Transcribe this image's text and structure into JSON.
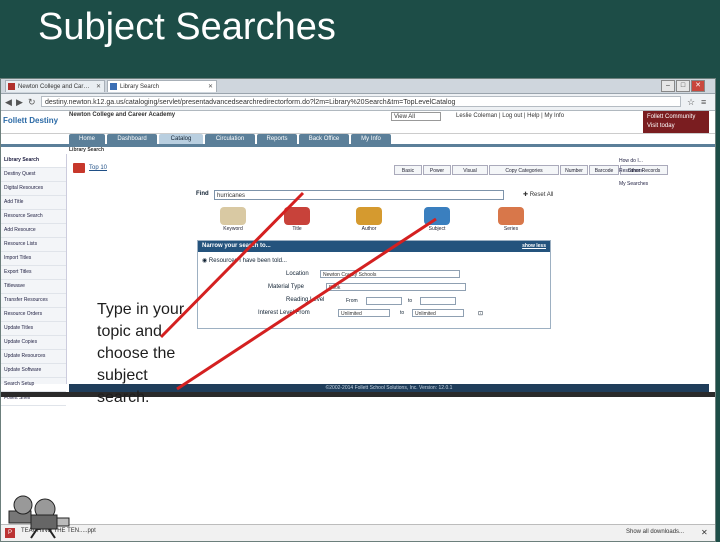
{
  "slide": {
    "title": "Subject Searches"
  },
  "callout": {
    "text": "Type in your topic and choose the subject search."
  },
  "browser": {
    "tabs": [
      {
        "label": "Newton College and Car…"
      },
      {
        "label": "Library Search"
      }
    ],
    "url": "destiny.newton.k12.ga.us/cataloging/servlet/presentadvancedsearchredirectorform.do?l2m=Library%20Search&tm=TopLevelCatalog"
  },
  "header": {
    "logo": "Follett Destiny",
    "school": "Newton College and Career Academy",
    "view_select": "View All",
    "user_links": "Leslie Coleman | Log out | Help | My Info",
    "community_title": "Follett Community",
    "community_link": "Visit today"
  },
  "nav": {
    "tabs": [
      {
        "label": "Home"
      },
      {
        "label": "Dashboard"
      },
      {
        "label": "Catalog"
      },
      {
        "label": "Circulation"
      },
      {
        "label": "Reports"
      },
      {
        "label": "Back Office"
      },
      {
        "label": "My Info"
      }
    ],
    "page_title": "Library Search"
  },
  "sidebar": {
    "items": [
      {
        "label": "Library Search"
      },
      {
        "label": "Destiny Quest"
      },
      {
        "label": "Digital Resources"
      },
      {
        "label": "Add Title"
      },
      {
        "label": "Resource Search"
      },
      {
        "label": "Add Resource"
      },
      {
        "label": "Resource Lists"
      },
      {
        "label": "Import Titles"
      },
      {
        "label": "Export Titles"
      },
      {
        "label": "Titlewave"
      },
      {
        "label": "Transfer Resources"
      },
      {
        "label": "Resource Orders"
      },
      {
        "label": "Update Titles"
      },
      {
        "label": "Update Copies"
      },
      {
        "label": "Update Resources"
      },
      {
        "label": "Update Software"
      },
      {
        "label": "Search Setup"
      },
      {
        "label": "Follett Shelf"
      }
    ]
  },
  "search": {
    "top_ten": "Top 10",
    "subtabs": [
      {
        "label": "Basic"
      },
      {
        "label": "Power"
      },
      {
        "label": "Visual"
      },
      {
        "label": "Copy Categories"
      },
      {
        "label": "Number"
      },
      {
        "label": "Barcode"
      },
      {
        "label": "Other Records"
      }
    ],
    "right_links": [
      "How do I...",
      "Resources",
      "My Searches"
    ],
    "find_label": "Find",
    "find_value": "hurricanes",
    "reset_label": "Reset All",
    "buttons": [
      {
        "label": "Keyword",
        "color": "#d9c9a3"
      },
      {
        "label": "Title",
        "color": "#c8423a"
      },
      {
        "label": "Author",
        "color": "#d59a2f"
      },
      {
        "label": "Subject",
        "color": "#3a7fbf"
      },
      {
        "label": "Series",
        "color": "#d8774a"
      }
    ]
  },
  "narrow": {
    "title": "Narrow your search to...",
    "show_less": "show less",
    "resources_row": "Resources I have been told...",
    "location_label": "Location",
    "location_value": "Newton County Schools",
    "material_label": "Material Type",
    "material_value": "Book",
    "reading_label": "Reading Level",
    "from_label": "From",
    "to_label": "to",
    "interest_label": "Interest Level From",
    "interest_from": "Unlimited",
    "interest_to": "Unlimited"
  },
  "footer": {
    "text": "©2002-2014 Follett School Solutions, Inc.     Version: 12.0.1"
  },
  "statusbar": {
    "download_name": "TEACHING THE TEN.....ppt",
    "show_all": "Show all downloads..."
  },
  "colors": {
    "slide_bg": "#1d4d47",
    "nav_blue": "#5b7f99",
    "annotation_red": "#d42020"
  }
}
